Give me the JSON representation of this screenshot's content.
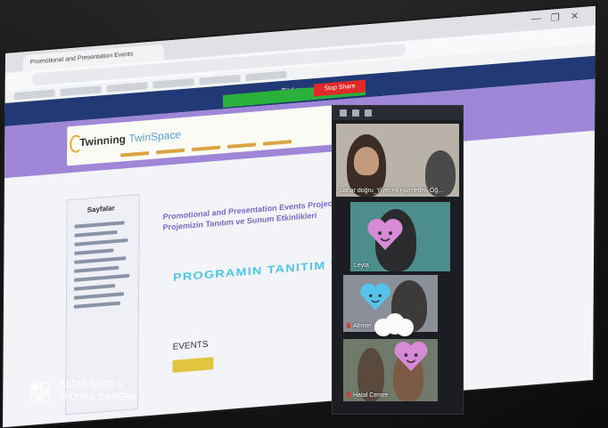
{
  "browser": {
    "tab_title": "Promotional and Presentation Events",
    "window_controls": [
      "—",
      "❐",
      "✕"
    ]
  },
  "website": {
    "language": "Türkçe",
    "logo_text": "Twinning",
    "logo_accent": "TwinSpace",
    "sidebar_title": "Sayfalar",
    "content_title": "Promotional and Presentation Events Project-Projemizin Tanıtım ve Sunum Etkinlikleri",
    "program_banner": "PROGRAMIN TANITIM VE SUNUM",
    "events_label": "EVENTS"
  },
  "zoom": {
    "stop_share_label": "Stop Share",
    "participants": [
      {
        "name": "bahar doğru_Yiyecek Hizmetleri Öğ..."
      },
      {
        "name": "Leyla"
      },
      {
        "name": "Ahmet"
      },
      {
        "name": "Hatal Cemre"
      }
    ]
  },
  "watermark": {
    "device": "REDMI NOTE 8",
    "camera": "AI QUAD CAMERA"
  },
  "colors": {
    "site_nav": "#213a75",
    "site_band": "#9f86d6",
    "share_green": "#29b13b",
    "stop_red": "#e02a2a",
    "heart_pink": "#d98ad6",
    "heart_blue": "#55c3ea"
  }
}
